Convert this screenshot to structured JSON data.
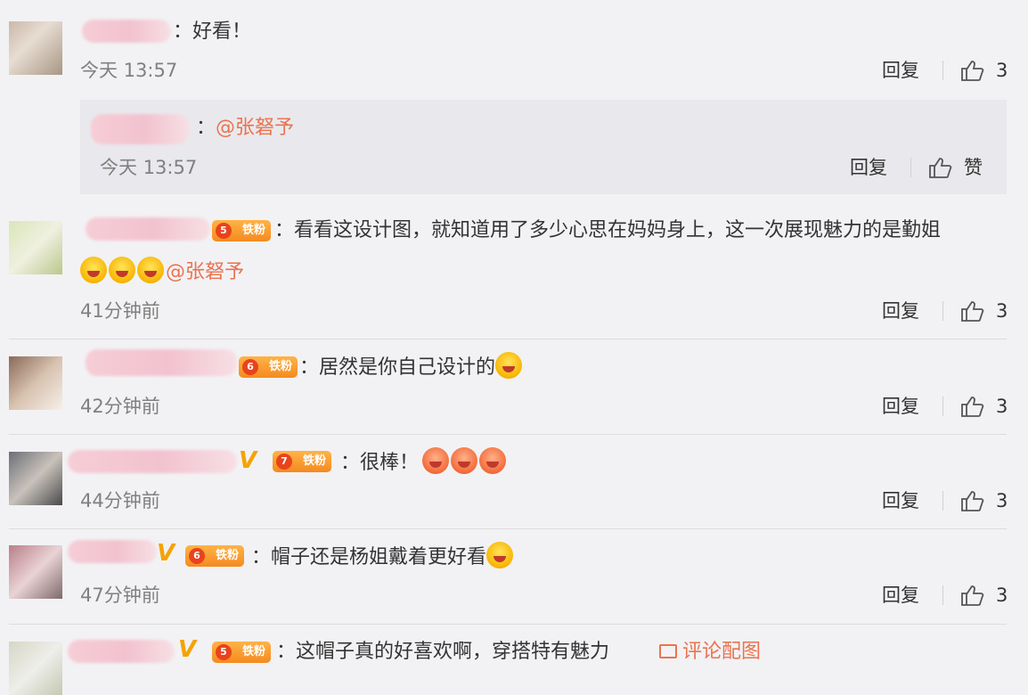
{
  "comments": [
    {
      "text": "：好看！",
      "time": "今天 13:57",
      "reply_label": "回复",
      "like_count": "3",
      "sub_reply": {
        "text_prefix": "：",
        "mention": "@张砮予",
        "time": "今天 13:57",
        "reply_label": "回复",
        "like_label": "赞"
      }
    },
    {
      "badge": "铁粉",
      "badge_level": "5",
      "text": "：看看这设计图，就知道用了多少心思在妈妈身上，这一次展现魅力的是勤姐",
      "mention": "@张砮予",
      "time": "41分钟前",
      "reply_label": "回复",
      "like_count": "3"
    },
    {
      "badge": "铁粉",
      "badge_level": "6",
      "text": "：居然是你自己设计的",
      "time": "42分钟前",
      "reply_label": "回复",
      "like_count": "3"
    },
    {
      "badge": "铁粉",
      "badge_level": "7",
      "text": "：很棒！",
      "time": "44分钟前",
      "reply_label": "回复",
      "like_count": "3"
    },
    {
      "badge": "铁粉",
      "badge_level": "6",
      "text": "：帽子还是杨姐戴着更好看",
      "time": "47分钟前",
      "reply_label": "回复",
      "like_count": "3"
    },
    {
      "badge": "铁粉",
      "badge_level": "5",
      "text": "：这帽子真的好喜欢啊，穿搭特有魅力",
      "pic_link": "评论配图"
    }
  ],
  "colors": {
    "mention": "#eb7350",
    "badge": "#f58a1f",
    "time": "#808080",
    "background": "#f2f2f5"
  }
}
